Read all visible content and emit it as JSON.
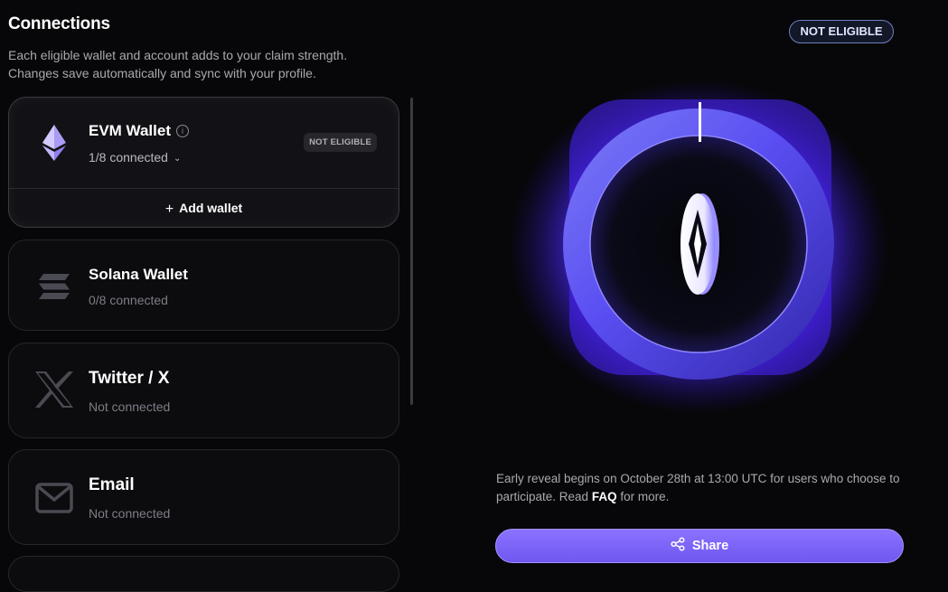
{
  "header": {
    "title": "Connections",
    "subtitle_line1": "Each eligible wallet and account adds to your claim strength.",
    "subtitle_line2": "Changes save automatically and sync with your profile."
  },
  "connections": [
    {
      "name": "EVM Wallet",
      "status": "1/8 connected",
      "badge": "NOT ELIGIBLE",
      "action": "Add wallet",
      "icon": "ethereum-icon"
    },
    {
      "name": "Solana Wallet",
      "status": "0/8 connected",
      "icon": "solana-icon"
    },
    {
      "name": "Twitter / X",
      "status": "Not connected",
      "icon": "x-icon"
    },
    {
      "name": "Email",
      "status": "Not connected",
      "icon": "mail-icon"
    }
  ],
  "status_badge": "NOT ELIGIBLE",
  "reveal_note": {
    "text_before": "Early reveal begins on October 28th at 13:00 UTC for users who choose to participate. Read ",
    "link": "FAQ",
    "text_after": " for more."
  },
  "share_button": {
    "label": "Share",
    "icon": "share-icon"
  },
  "colors": {
    "accent": "#7b61ff",
    "background": "#070709",
    "glow": "#4b2bff"
  }
}
